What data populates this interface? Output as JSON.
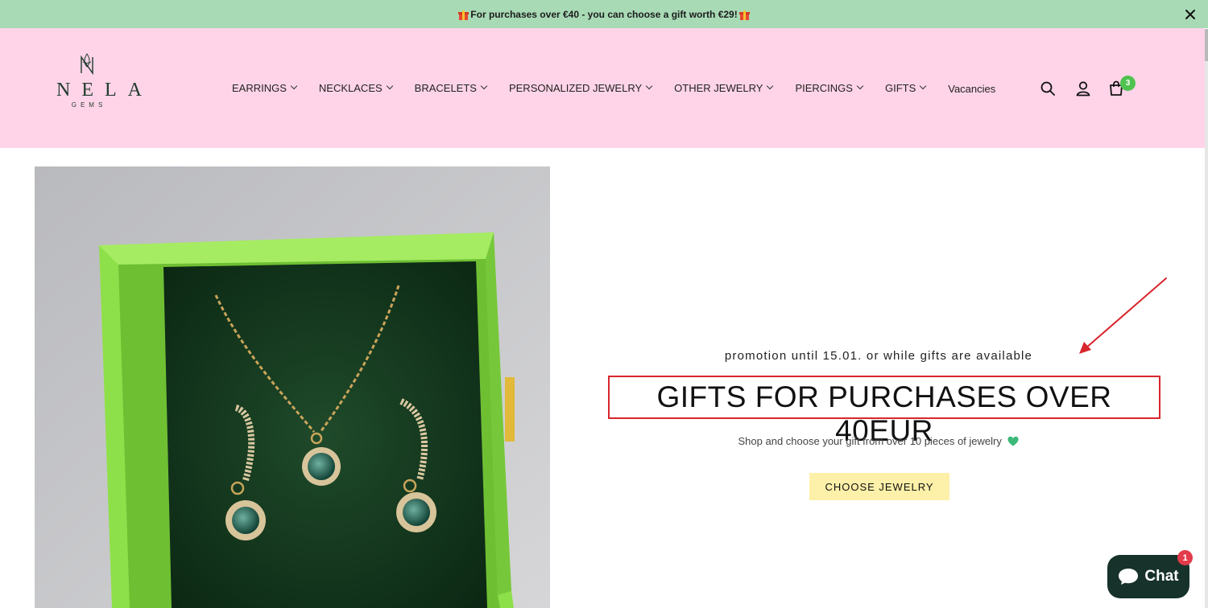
{
  "announcement": {
    "text": "For purchases over €40 - you can choose a gift worth €29!",
    "close_icon": "close-icon",
    "gift_icon": "gift-icon"
  },
  "header": {
    "logo": {
      "name": "NELA",
      "sub": "GEMS"
    },
    "nav": [
      {
        "label": "EARRINGS",
        "dropdown": true
      },
      {
        "label": "NECKLACES",
        "dropdown": true
      },
      {
        "label": "BRACELETS",
        "dropdown": true
      },
      {
        "label": "PERSONALIZED JEWELRY",
        "dropdown": true
      },
      {
        "label": "OTHER JEWELRY",
        "dropdown": true
      },
      {
        "label": "PIERCINGS",
        "dropdown": true
      },
      {
        "label": "GIFTS",
        "dropdown": true
      },
      {
        "label": "Vacancies",
        "dropdown": false
      }
    ],
    "icons": [
      "search-icon",
      "account-icon",
      "cart-icon"
    ],
    "cart_count": "3"
  },
  "hero": {
    "subtitle": "promotion until 15.01. or while gifts are available",
    "title": "GIFTS FOR PURCHASES OVER 40EUR",
    "description": "Shop and choose your gift from over 10 pieces of jewelry",
    "cta_label": "CHOOSE JEWELRY"
  },
  "chat": {
    "label": "Chat",
    "badge": "1"
  },
  "colors": {
    "announcement_bg": "#a8dab5",
    "header_bg": "#ffd4e8",
    "cta_bg": "#fdf0a8",
    "highlight_border": "#d8262d",
    "chat_bg": "#16322a"
  }
}
